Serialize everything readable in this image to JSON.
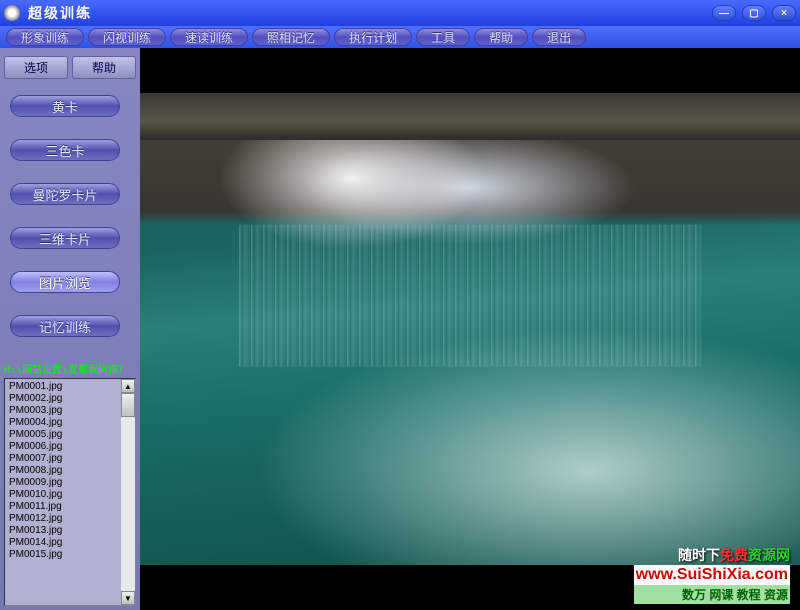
{
  "window": {
    "title": "超级训练"
  },
  "menubar": {
    "items": [
      {
        "label": "形象训练"
      },
      {
        "label": "闪视训练"
      },
      {
        "label": "速读训练"
      },
      {
        "label": "照相记忆"
      },
      {
        "label": "执行计划"
      },
      {
        "label": "工具"
      },
      {
        "label": "帮助"
      },
      {
        "label": "退出"
      }
    ]
  },
  "sidebar": {
    "top_buttons": {
      "options": "选项",
      "help": "帮助"
    },
    "buttons": [
      {
        "label": "黄卡"
      },
      {
        "label": "三色卡"
      },
      {
        "label": "曼陀罗卡片"
      },
      {
        "label": "三维卡片"
      },
      {
        "label": "图片浏览",
        "active": true
      },
      {
        "label": "记忆训练"
      }
    ],
    "path": "H:\\网站设置\\发帮我网络？",
    "files": [
      "PM0001.jpg",
      "PM0002.jpg",
      "PM0003.jpg",
      "PM0004.jpg",
      "PM0005.jpg",
      "PM0006.jpg",
      "PM0007.jpg",
      "PM0008.jpg",
      "PM0009.jpg",
      "PM0010.jpg",
      "PM0011.jpg",
      "PM0012.jpg",
      "PM0013.jpg",
      "PM0014.jpg",
      "PM0015.jpg"
    ]
  },
  "watermark": {
    "line1_a": "随时下",
    "line1_b": "免费",
    "line1_c": "资源网",
    "line2": "www.SuiShiXia.com",
    "line3": "数万 网课 教程 资源"
  }
}
